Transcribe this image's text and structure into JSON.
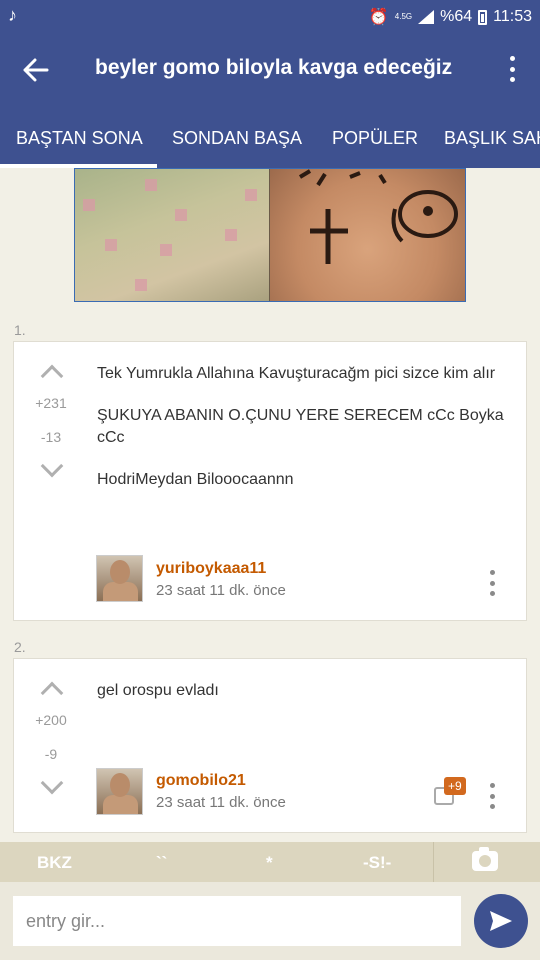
{
  "status_bar": {
    "note_icon": "music-note-icon",
    "network": "4.5G",
    "battery_percent": "%64",
    "time": "11:53"
  },
  "app_bar": {
    "title": "beyler gomo biloyla kavga edeceğiz"
  },
  "tabs": [
    {
      "label": "BAŞTAN SONA",
      "active": true
    },
    {
      "label": "SONDAN BAŞA"
    },
    {
      "label": "POPÜLER"
    },
    {
      "label": "BAŞLIK SAHİBİ"
    }
  ],
  "entries": [
    {
      "number": "1.",
      "upvotes": "+231",
      "downvotes": "-13",
      "paragraphs": [
        "Tek Yumrukla Allahına Kavuşturacağm pici sizce kim alır",
        "ŞUKUYA ABANIN O.ÇUNU YERE SERECEM cCc Boyka cCc",
        "HodriMeydan Bilooocaannn"
      ],
      "author": "yuriboykaaa11",
      "time": "23 saat 11 dk. önce"
    },
    {
      "number": "2.",
      "upvotes": "+200",
      "downvotes": "-9",
      "paragraphs": [
        "gel orospu evladı"
      ],
      "author": "gomobilo21",
      "time": "23 saat 11 dk. önce",
      "comment_count": "+9"
    }
  ],
  "quick_bar": {
    "bkz": "BKZ",
    "backticks": "``",
    "star": "*",
    "spoiler": "-S!-"
  },
  "input": {
    "placeholder": "entry gir..."
  },
  "colors": {
    "primary": "#3e5190",
    "author": "#c45a00",
    "background": "#f2f0e6",
    "badge": "#d2691e"
  }
}
